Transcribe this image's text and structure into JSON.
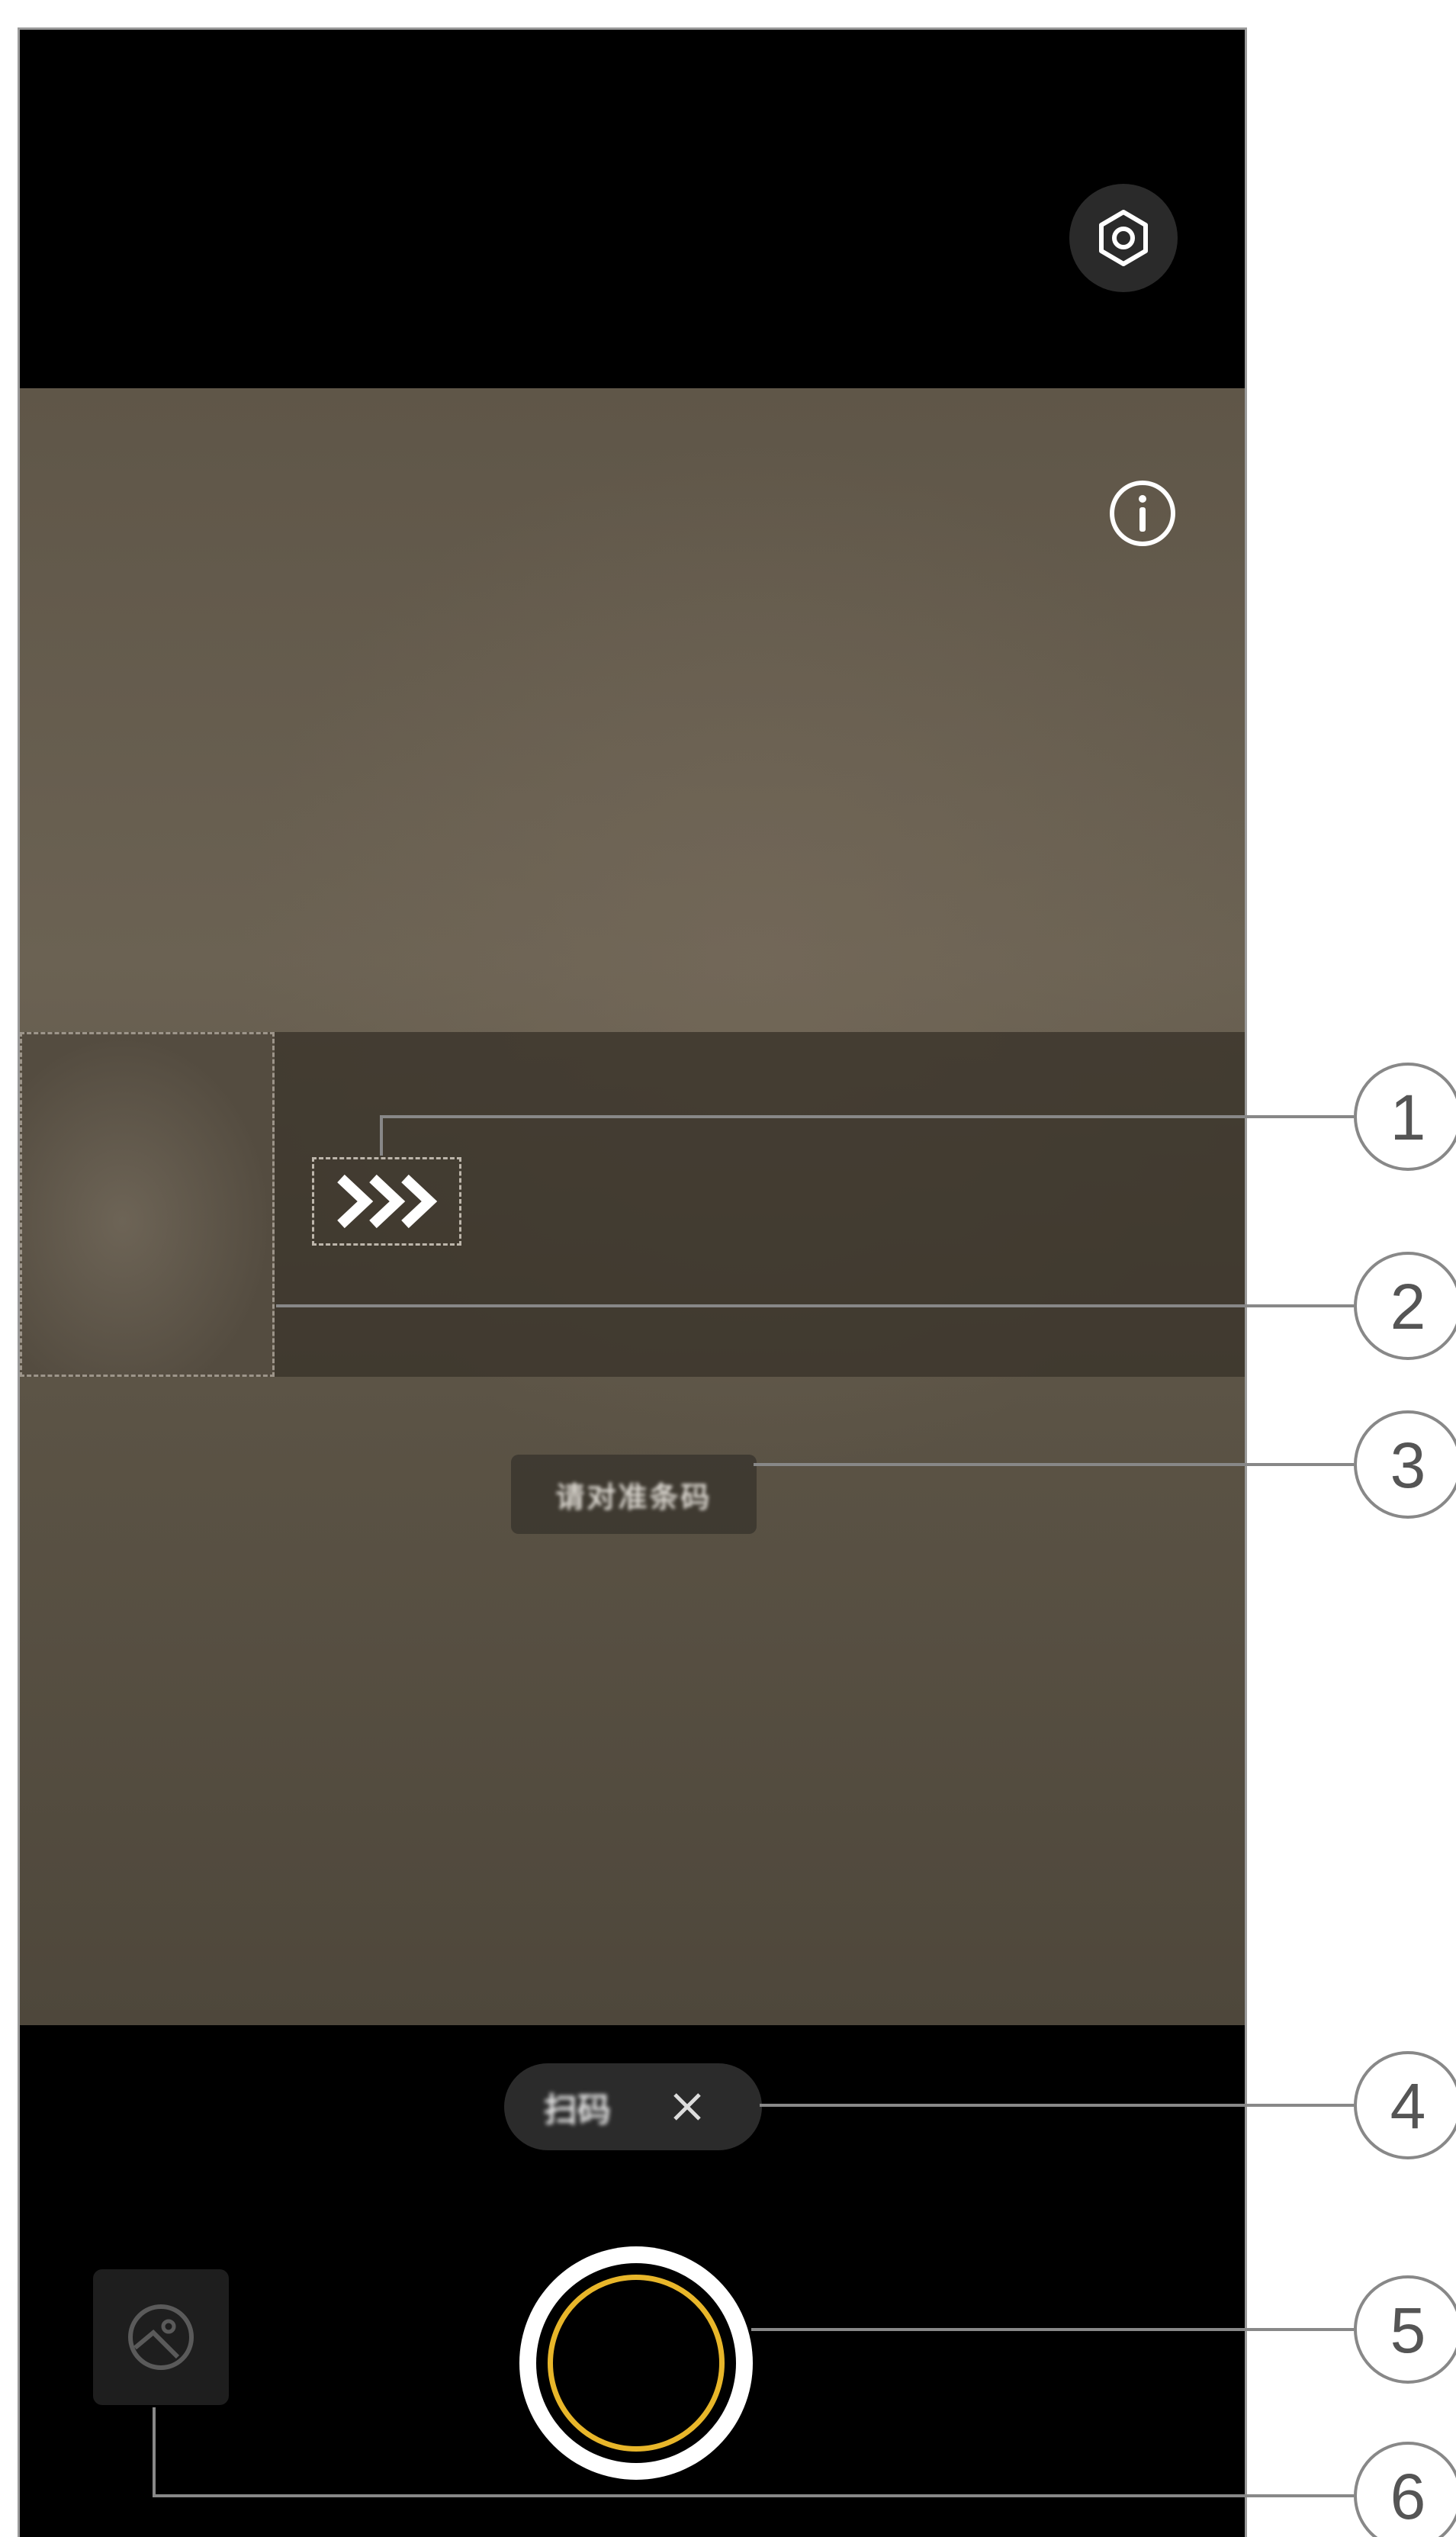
{
  "hint": {
    "text": "请对准条码"
  },
  "mode_chip": {
    "label": "扫码"
  },
  "callouts": [
    "1",
    "2",
    "3",
    "4",
    "5",
    "6"
  ],
  "colors": {
    "viewfinder": "#5f5648",
    "shutter_ring": "#e8b62a",
    "chrome": "#000000"
  },
  "icons": [
    "settings-icon",
    "info-icon",
    "chevron-arrows-icon",
    "close-icon",
    "gallery-icon"
  ]
}
